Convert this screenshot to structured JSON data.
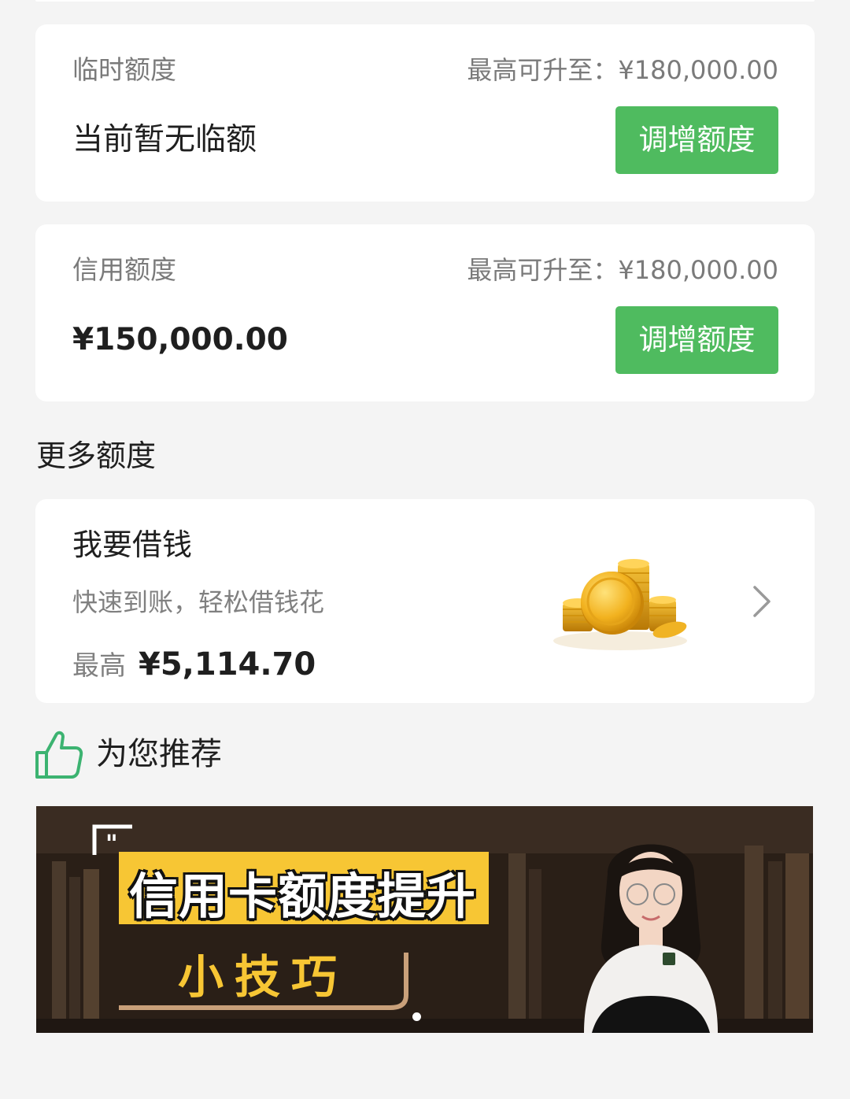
{
  "temp_quota": {
    "label": "临时额度",
    "max_text": "最高可升至：¥180,000.00",
    "value": "当前暂无临额",
    "button": "调增额度"
  },
  "credit_quota": {
    "label": "信用额度",
    "max_text": "最高可升至：¥180,000.00",
    "value": "¥150,000.00",
    "button": "调增额度"
  },
  "more_quota": {
    "section_title": "更多额度",
    "loan_card": {
      "title": "我要借钱",
      "subtitle": "快速到账，轻松借钱花",
      "max_label": "最高",
      "max_value": "¥5,114.70",
      "icon": "gold-coins-icon",
      "chevron": "chevron-right-icon"
    }
  },
  "recommend": {
    "title": "为您推荐",
    "icon": "thumbs-up-icon",
    "banner": {
      "title": "信用卡额度提升",
      "subtitle": "小技巧",
      "quote_mark": "\"",
      "carousel_index": 1,
      "carousel_count": 1
    }
  },
  "colors": {
    "accent_green": "#4fbb5f",
    "banner_yellow": "#f7c634",
    "background": "#f4f4f4"
  }
}
